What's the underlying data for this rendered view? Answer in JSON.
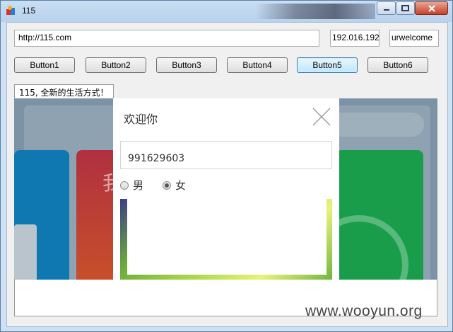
{
  "window": {
    "title": "115",
    "controls": {
      "minimize": "minimize",
      "maximize": "maximize",
      "close": "close"
    }
  },
  "toolbar": {
    "url": "http://115.com",
    "field2": "192.016.192",
    "field3": "urwelcome"
  },
  "buttons": [
    "Button1",
    "Button2",
    "Button3",
    "Button4",
    "Button5",
    "Button6"
  ],
  "focused_button": "Button5",
  "status_label": "115, 全新的生活方式！",
  "web": {
    "tile_char": "我"
  },
  "dialog": {
    "title": "欢迎你",
    "input_value": "991629603",
    "radio_options": [
      {
        "label": "男",
        "selected": false
      },
      {
        "label": "女",
        "selected": true
      }
    ]
  },
  "watermark": "www.wooyun.org",
  "icons": {
    "app": "app-icon",
    "close": "close-icon"
  },
  "colors": {
    "titlebar": "#b8d2ec",
    "close_button": "#c7412a",
    "focused_button_border": "#3c7fb1",
    "tile_blue": "#0f78b0",
    "tile_red": "#b03040",
    "tile_green": "#1a9d4a"
  }
}
